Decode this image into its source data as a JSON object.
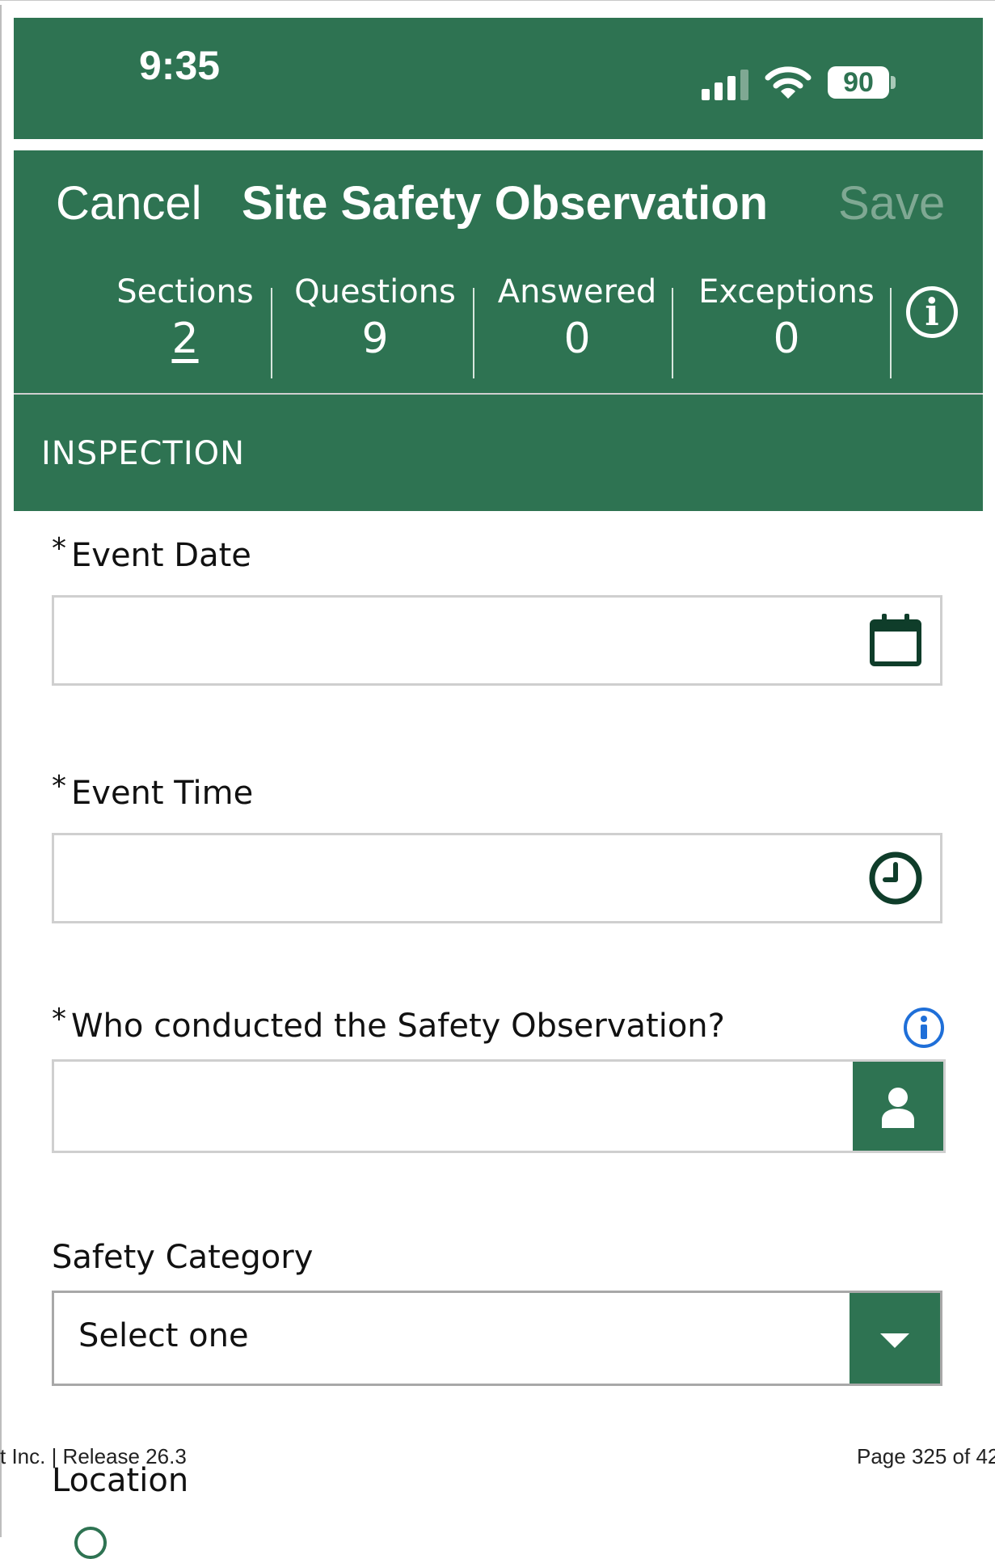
{
  "colors": {
    "brand_green": "#2e7352",
    "disabled_save": "#7fa893",
    "info_blue": "#1f6fd8",
    "border_gray": "#cfcfcf"
  },
  "status_bar": {
    "time": "9:35",
    "battery": "90",
    "icons": [
      "cellular-signal-icon",
      "wifi-icon",
      "battery-icon"
    ]
  },
  "nav": {
    "cancel": "Cancel",
    "title": "Site Safety Observation",
    "save": "Save"
  },
  "stats": [
    {
      "label": "Sections",
      "value": "2"
    },
    {
      "label": "Questions",
      "value": "9"
    },
    {
      "label": "Answered",
      "value": "0"
    },
    {
      "label": "Exceptions",
      "value": "0"
    }
  ],
  "section": {
    "title": "INSPECTION"
  },
  "fields": {
    "event_date": {
      "required_mark": "*",
      "label": "Event Date",
      "value": "",
      "icon": "calendar-icon"
    },
    "event_time": {
      "required_mark": "*",
      "label": "Event Time",
      "value": "",
      "icon": "clock-icon"
    },
    "conducted_by": {
      "required_mark": "*",
      "label": "Who conducted the Safety Observation?",
      "value": "",
      "icon": "person-icon"
    },
    "safety_category": {
      "label": "Safety Category",
      "selected": "Select one",
      "icon": "caret-down-icon"
    },
    "location": {
      "label": "Location"
    }
  },
  "footer": {
    "left": "t Inc.  |  Release 26.3",
    "right": "Page 325 of 42"
  }
}
